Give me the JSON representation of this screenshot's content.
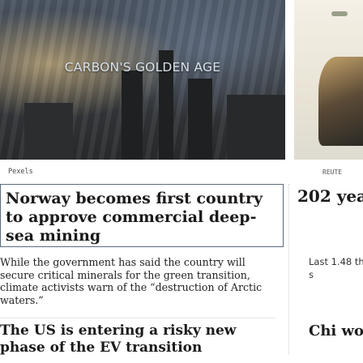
{
  "main_story": {
    "image_caption": "CARBON'S GOLDEN AGE",
    "image_credit": "Pexels",
    "headline": "Norway becomes first country to approve commercial deep-sea mining",
    "summary": "While the government has said the country will secure critical minerals for the green transition, climate activists warn of the “destruction of Arctic waters.”"
  },
  "side_story": {
    "image_credit": "REUTE",
    "headline": "202 yea",
    "summary": "Last 1.48 the s"
  },
  "next_story": {
    "headline": "The US is entering a risky new phase of the EV transition"
  },
  "next_side_story": {
    "headline": "Chi wor"
  }
}
